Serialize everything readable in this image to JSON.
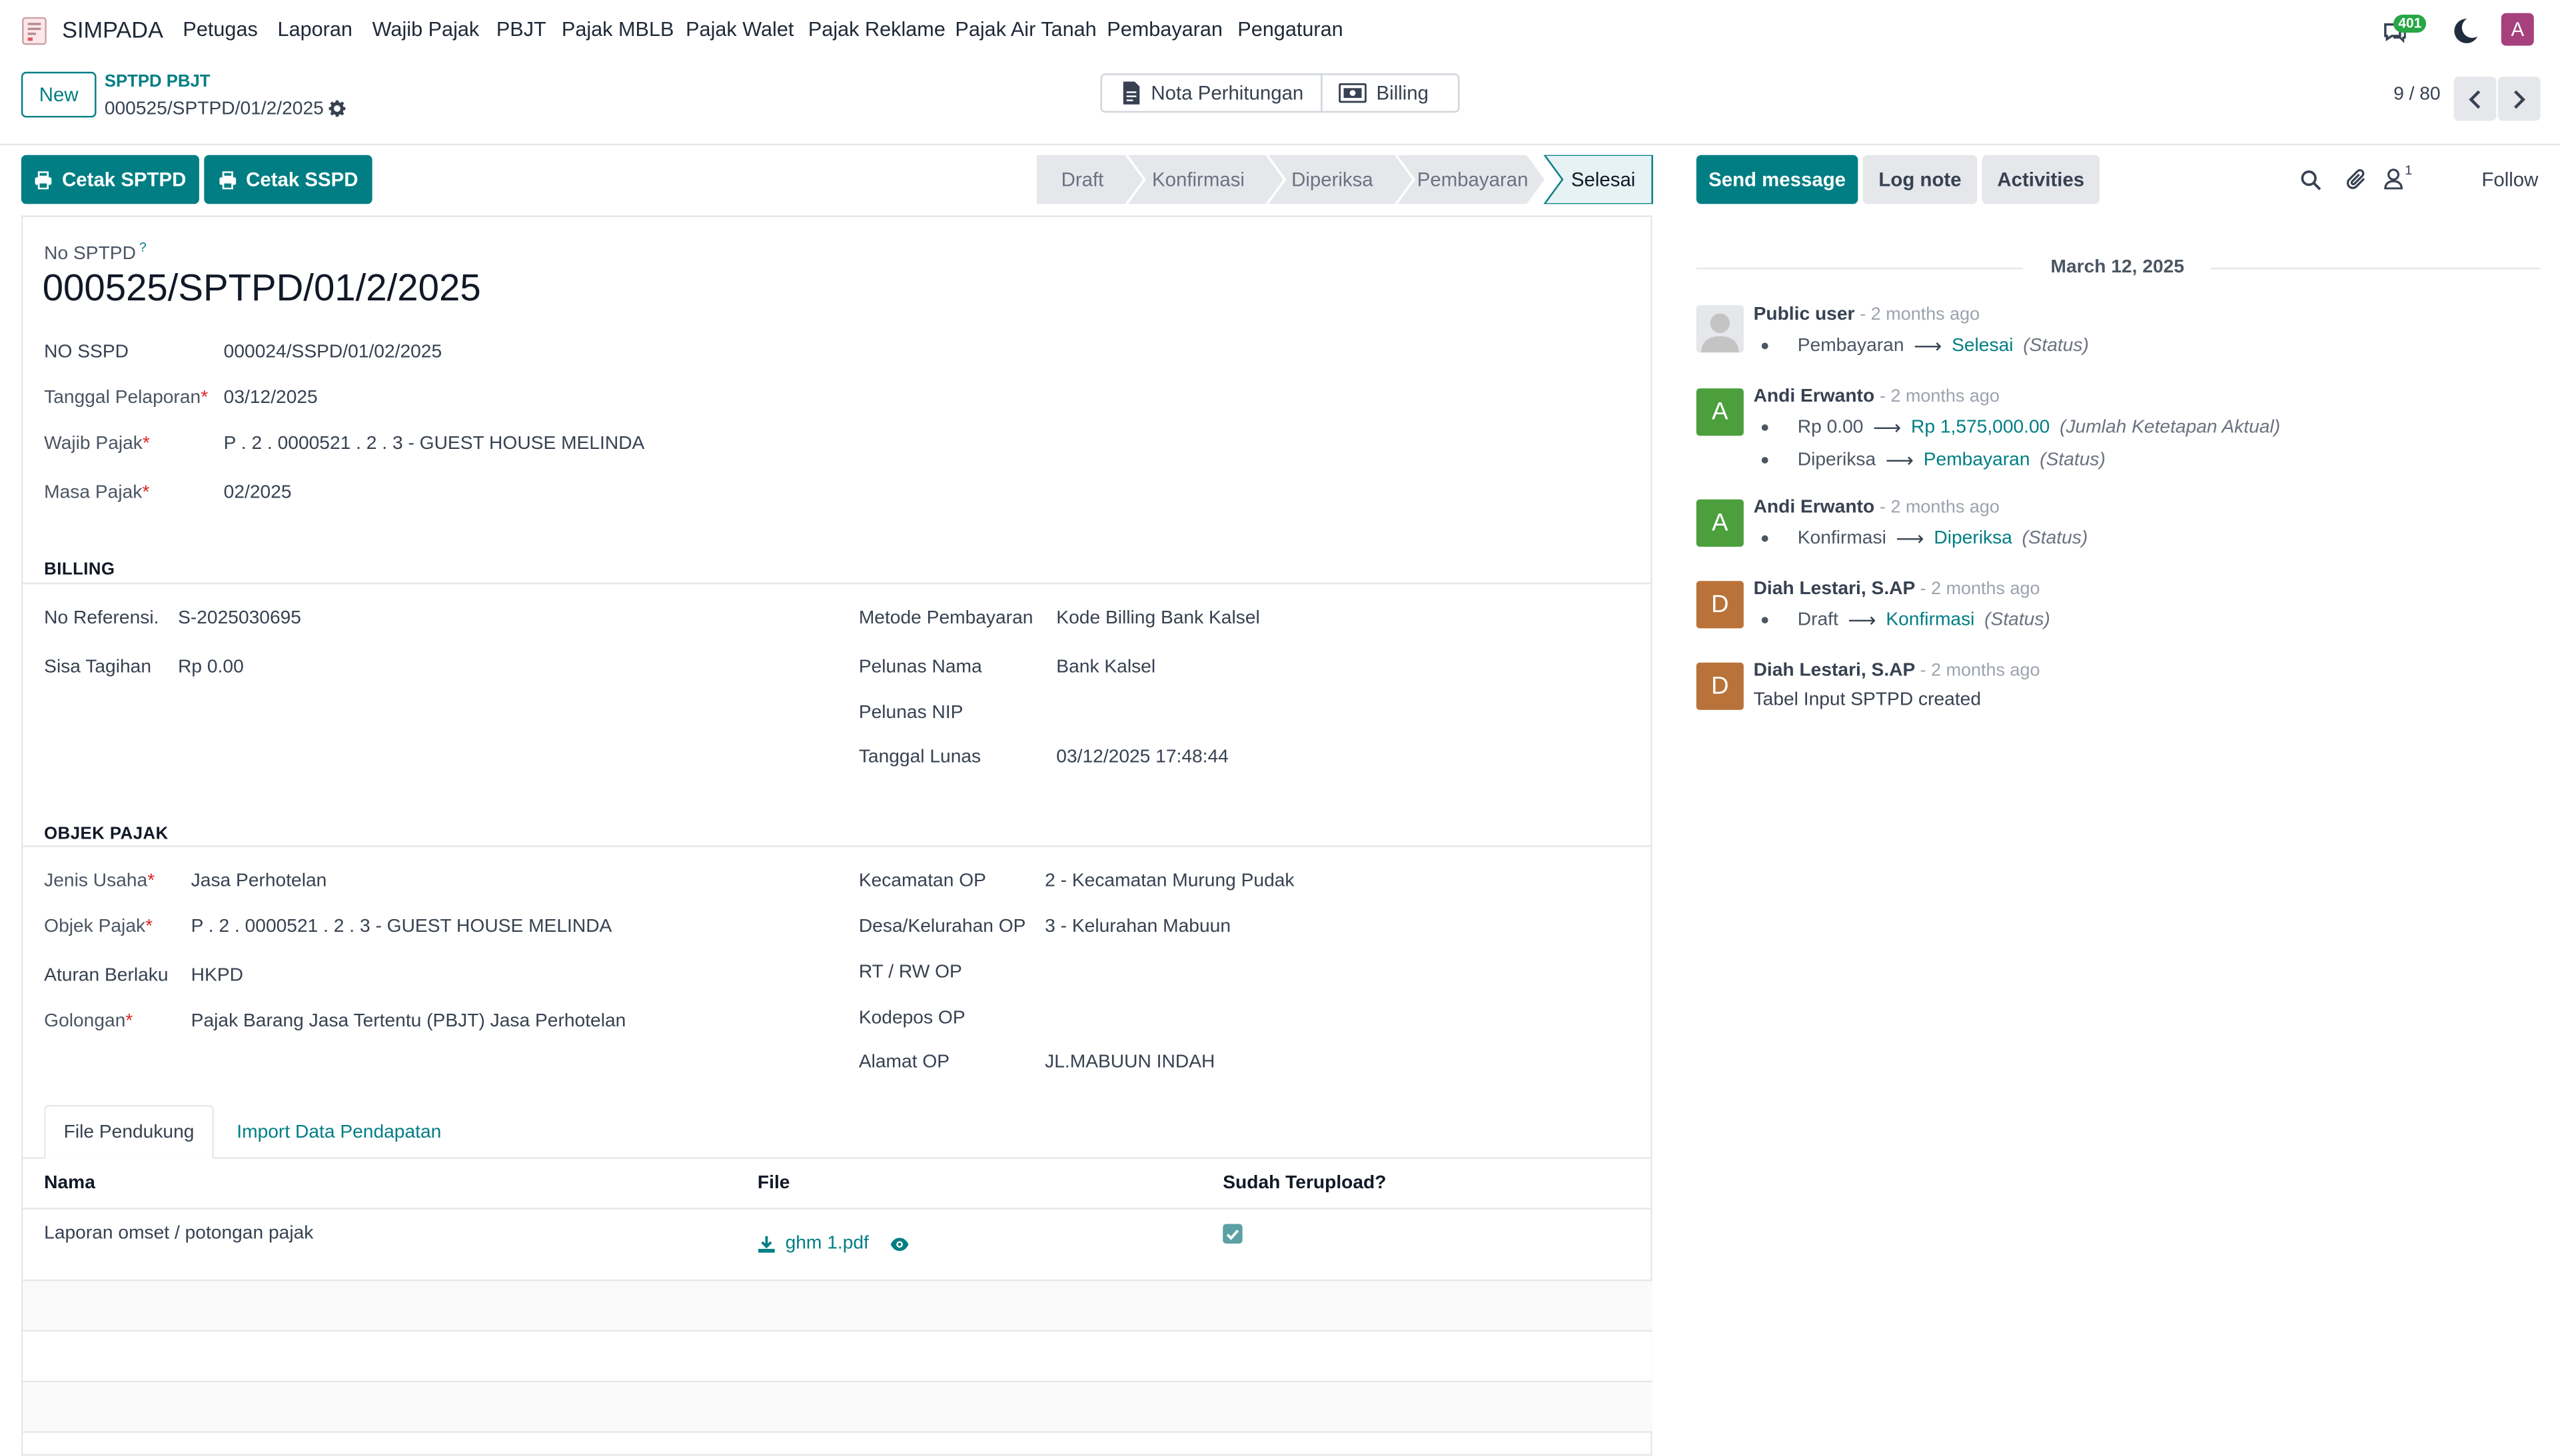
{
  "navbar": {
    "app_name": "SIMPADA",
    "menus": [
      "Petugas",
      "Laporan",
      "Wajib Pajak",
      "PBJT",
      "Pajak MBLB",
      "Pajak Walet",
      "Pajak Reklame",
      "Pajak Air Tanah",
      "Pembayaran",
      "Pengaturan"
    ],
    "notification_count": "401",
    "user_initial": "A"
  },
  "control_panel": {
    "new_label": "New",
    "breadcrumb_parent": "SPTPD PBJT",
    "record_name": "000525/SPTPD/01/2/2025",
    "smart_buttons": [
      "Nota Perhitungan",
      "Billing"
    ],
    "pager": "9 / 80"
  },
  "actions": {
    "cetak_sptpd": "Cetak SPTPD",
    "cetak_sspd": "Cetak SSPD"
  },
  "statusbar": {
    "stages": [
      "Draft",
      "Konfirmasi",
      "Diperiksa",
      "Pembayaran",
      "Selesai"
    ],
    "active": "Selesai"
  },
  "form": {
    "no_sptpd_label": "No SPTPD",
    "no_sptpd_tooltip": "?",
    "no_sptpd": "000525/SPTPD/01/2/2025",
    "header_fields": [
      {
        "label": "NO SSPD",
        "value": "000024/SSPD/01/02/2025",
        "required": false,
        "link": false
      },
      {
        "label": "Tanggal Pelaporan",
        "value": "03/12/2025",
        "required": true,
        "link": false
      },
      {
        "label": "Wajib Pajak",
        "value": "P . 2 . 0000521 . 2 . 3 - GUEST HOUSE MELINDA",
        "required": true,
        "link": true
      },
      {
        "label": "Masa Pajak",
        "value": "02/2025",
        "required": true,
        "link": false
      }
    ],
    "billing": {
      "title": "BILLING",
      "no_referensi_label": "No Referensi.",
      "no_referensi": "S-2025030695",
      "sisa_tagihan_label": "Sisa Tagihan",
      "sisa_tagihan": "Rp 0.00",
      "metode_label": "Metode Pembayaran",
      "metode": "Kode Billing Bank Kalsel",
      "pelunas_nama_label": "Pelunas Nama",
      "pelunas_nama": "Bank Kalsel",
      "pelunas_nip_label": "Pelunas NIP",
      "pelunas_nip": "",
      "tanggal_lunas_label": "Tanggal Lunas",
      "tanggal_lunas": "03/12/2025 17:48:44"
    },
    "objek_pajak": {
      "title": "OBJEK PAJAK",
      "jenis_usaha_label": "Jenis Usaha",
      "jenis_usaha": "Jasa Perhotelan",
      "objek_pajak_label": "Objek Pajak",
      "objek_pajak": "P . 2 . 0000521 . 2 . 3 - GUEST HOUSE MELINDA",
      "aturan_label": "Aturan Berlaku",
      "aturan": "HKPD",
      "golongan_label": "Golongan",
      "golongan": "Pajak Barang Jasa Tertentu (PBJT) Jasa Perhotelan",
      "kecamatan_label": "Kecamatan OP",
      "kecamatan": "2 - Kecamatan Murung Pudak",
      "desa_label": "Desa/Kelurahan OP",
      "desa": "3 - Kelurahan Mabuun",
      "rtrw_label": "RT / RW OP",
      "rtrw": "",
      "kodepos_label": "Kodepos OP",
      "kodepos": "",
      "alamat_label": "Alamat OP",
      "alamat": "JL.MABUUN INDAH"
    },
    "tabs": [
      "File Pendukung",
      "Import Data Pendapatan"
    ],
    "table": {
      "headers": [
        "Nama",
        "File",
        "Sudah Terupload?"
      ],
      "rows": [
        {
          "nama": "Laporan omset / potongan pajak",
          "file": "ghm 1.pdf",
          "uploaded": true
        }
      ]
    }
  },
  "chatter": {
    "send_message": "Send message",
    "log_note": "Log note",
    "activities": "Activities",
    "follow": "Follow",
    "followers_count": "1",
    "date_separator": "March 12, 2025",
    "messages": [
      {
        "author": "Public user",
        "date": "- 2 months ago",
        "avatar": "",
        "color": "#d1d5db",
        "changes": [
          {
            "old": "Pembayaran",
            "new": "Selesai",
            "field": "(Status)"
          }
        ]
      },
      {
        "author": "Andi Erwanto",
        "date": "- 2 months ago",
        "avatar": "A",
        "color": "#4d9f3e",
        "changes": [
          {
            "old": "Rp 0.00",
            "new": "Rp 1,575,000.00",
            "field": "(Jumlah Ketetapan Aktual)"
          },
          {
            "old": "Diperiksa",
            "new": "Pembayaran",
            "field": "(Status)"
          }
        ]
      },
      {
        "author": "Andi Erwanto",
        "date": "- 2 months ago",
        "avatar": "A",
        "color": "#4d9f3e",
        "changes": [
          {
            "old": "Konfirmasi",
            "new": "Diperiksa",
            "field": "(Status)"
          }
        ]
      },
      {
        "author": "Diah Lestari, S.AP",
        "date": "- 2 months ago",
        "avatar": "D",
        "color": "#b9733a",
        "changes": [
          {
            "old": "Draft",
            "new": "Konfirmasi",
            "field": "(Status)"
          }
        ]
      },
      {
        "author": "Diah Lestari, S.AP",
        "date": "- 2 months ago",
        "avatar": "D",
        "color": "#b9733a",
        "body": "Tabel Input SPTPD created"
      }
    ]
  }
}
